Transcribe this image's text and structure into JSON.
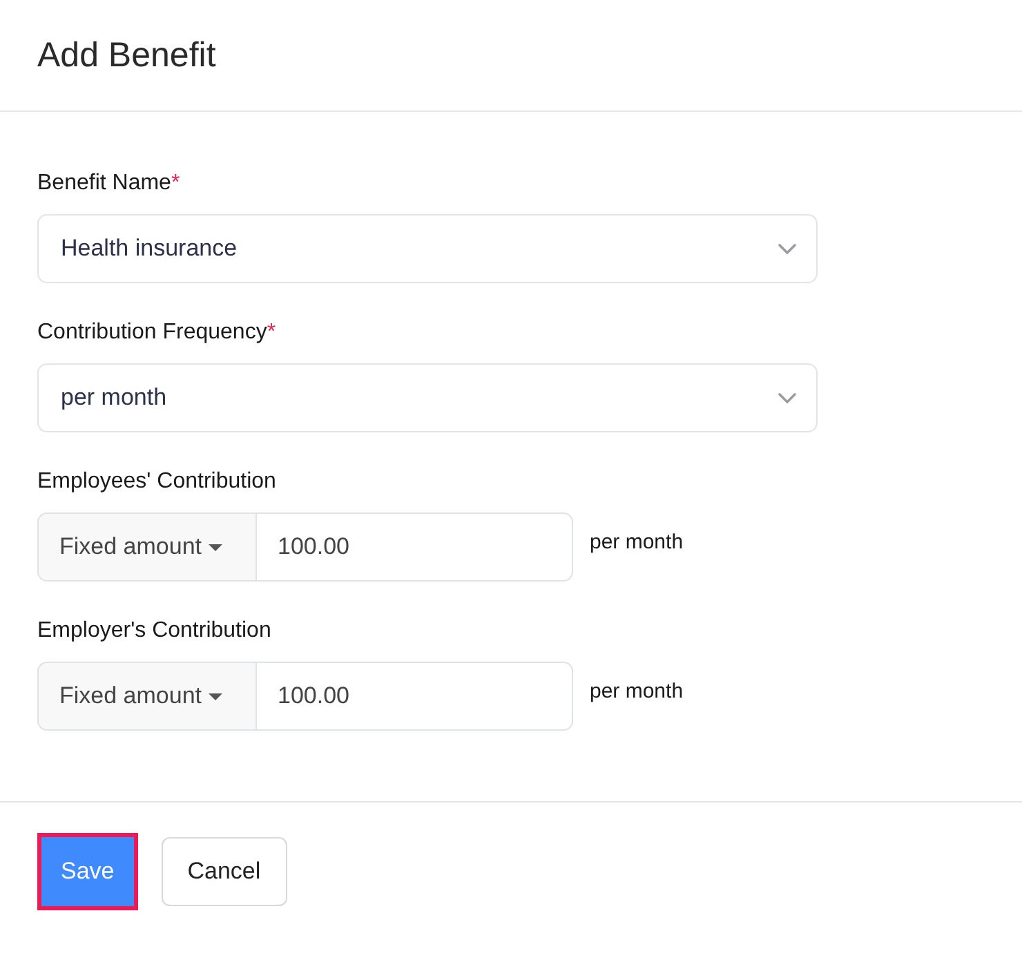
{
  "title": "Add Benefit",
  "fields": [
    {
      "kind": "select",
      "label": "Benefit Name",
      "required_mark": "*",
      "value": "Health insurance"
    },
    {
      "kind": "select",
      "label": "Contribution Frequency",
      "required_mark": "*",
      "value": "per month"
    },
    {
      "kind": "amount",
      "label": "Employees' Contribution",
      "type": "Fixed amount",
      "value": "100.00",
      "suffix": "per month"
    },
    {
      "kind": "amount",
      "label": "Employer's Contribution",
      "type": "Fixed amount",
      "value": "100.00",
      "suffix": "per month"
    }
  ],
  "buttons": [
    {
      "label": "Save",
      "kind": "primary",
      "highlighted": true
    },
    {
      "label": "Cancel",
      "kind": "secondary",
      "highlighted": false
    }
  ]
}
